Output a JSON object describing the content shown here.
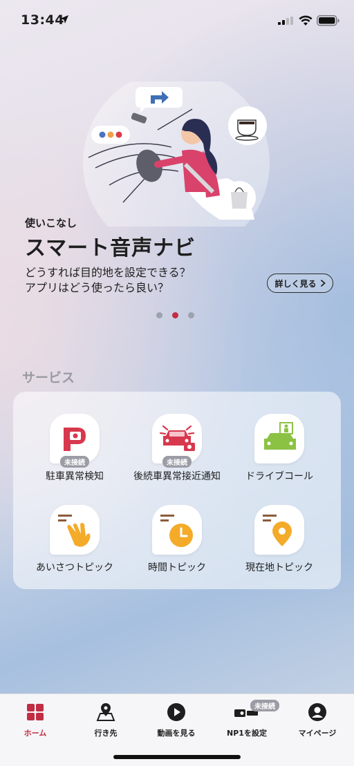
{
  "status_bar": {
    "time": "13:44"
  },
  "hero": {
    "eyebrow": "使いこなし",
    "title": "スマート音声ナビ",
    "desc_line1": "どうすれば目的地を設定できる？",
    "desc_line2": "アプリはどう使ったら良い？",
    "detail_button": "詳しく見る",
    "carousel_active_index": 1,
    "carousel_count": 3
  },
  "services": {
    "title": "サービス",
    "items": [
      {
        "label": "駐車異常検知",
        "badge": "未接続",
        "icon": "parking-camera-icon"
      },
      {
        "label": "後続車異常接近通知",
        "badge": "未接続",
        "icon": "rear-car-alert-icon"
      },
      {
        "label": "ドライブコール",
        "icon": "drive-call-icon"
      },
      {
        "label": "あいさつトピック",
        "icon": "waving-hand-icon"
      },
      {
        "label": "時間トピック",
        "icon": "clock-icon"
      },
      {
        "label": "現在地トピック",
        "icon": "location-pin-icon"
      }
    ]
  },
  "nav": {
    "items": [
      {
        "label": "ホーム",
        "icon": "grid-icon",
        "active": true
      },
      {
        "label": "行き先",
        "icon": "map-pin-icon"
      },
      {
        "label": "動画を見る",
        "icon": "play-icon"
      },
      {
        "label": "NP1を設定",
        "icon": "device-icon",
        "badge": "未接続"
      },
      {
        "label": "マイページ",
        "icon": "user-icon"
      }
    ]
  },
  "colors": {
    "accent": "#c22d44",
    "badge": "#9c9ca6"
  }
}
